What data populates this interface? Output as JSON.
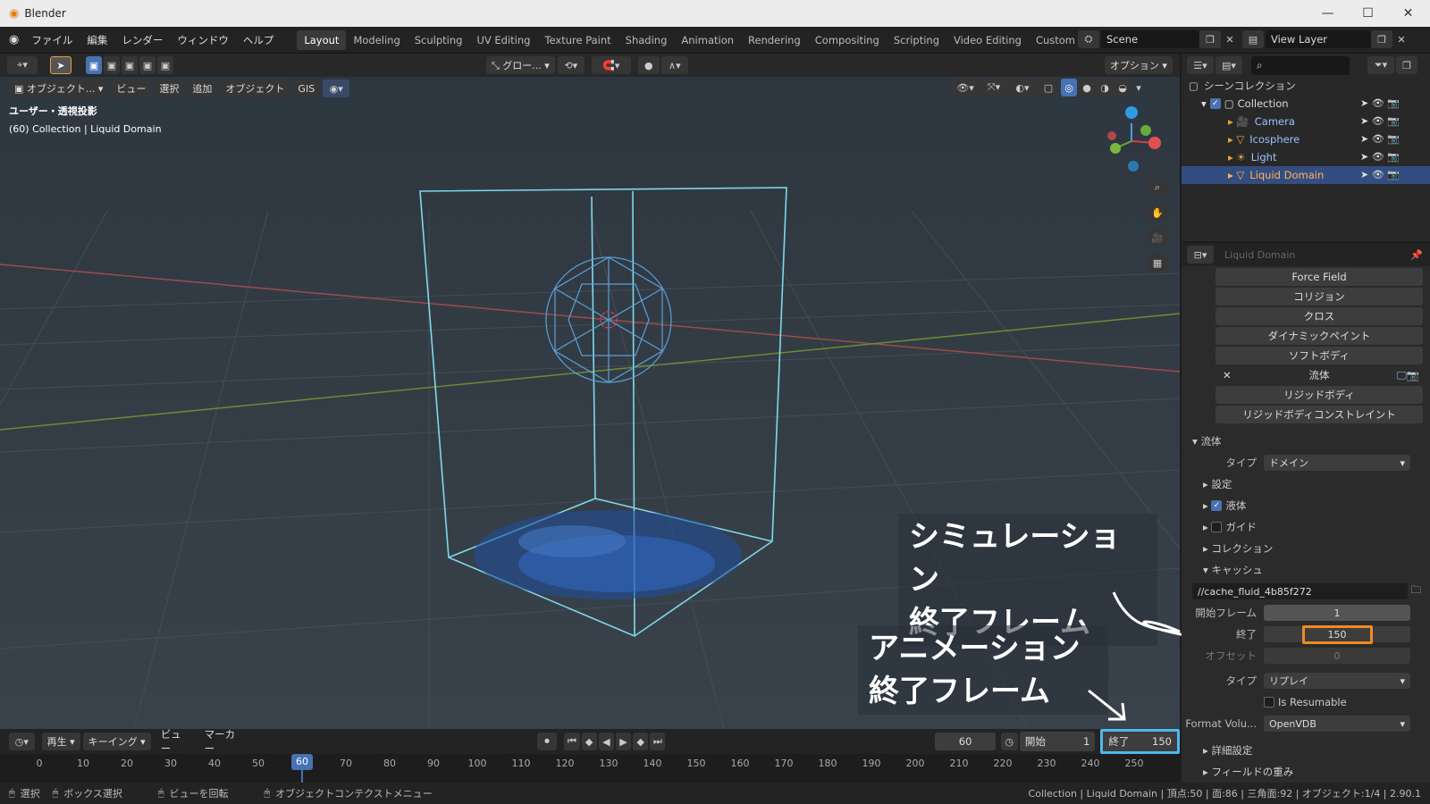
{
  "title_bar": {
    "app_name": "Blender"
  },
  "menu": [
    "ファイル",
    "編集",
    "レンダー",
    "ウィンドウ",
    "ヘルプ"
  ],
  "workspaces": [
    "Layout",
    "Modeling",
    "Sculpting",
    "UV Editing",
    "Texture Paint",
    "Shading",
    "Animation",
    "Rendering",
    "Compositing",
    "Scripting",
    "Video Editing",
    "Custom"
  ],
  "scene_name": "Scene",
  "view_layer": "View Layer",
  "toolbar": {
    "transform": "グロー...",
    "options": "オプション"
  },
  "header": {
    "mode": "オブジェクト...",
    "view": "ビュー",
    "select": "選択",
    "add": "追加",
    "object": "オブジェクト",
    "gis": "GIS"
  },
  "viewport": {
    "projection": "ユーザー・透視投影",
    "collection_info": "(60) Collection | Liquid Domain"
  },
  "outliner": {
    "root": "シーンコレクション",
    "items": [
      "Collection",
      "Camera",
      "Icosphere",
      "Light",
      "Liquid Domain"
    ]
  },
  "properties": {
    "object_name": "Liquid Domain",
    "physics_buttons": [
      "Force Field",
      "コリジョン",
      "クロス",
      "ダイナミックペイント",
      "ソフトボディ",
      "流体",
      "リジッドボディ",
      "リジッドボディコンストレイント"
    ],
    "fluid_panel": "流体",
    "type_label": "タイプ",
    "type_value": "ドメイン",
    "settings": "設定",
    "liquid": "液体",
    "guide": "ガイド",
    "collections": "コレクション",
    "cache": "キャッシュ",
    "cache_path": "//cache_fluid_4b85f272",
    "start_label": "開始フレーム",
    "start_value": "1",
    "end_label": "終了",
    "end_value": "150",
    "offset_label": "オフセット",
    "offset_value": "0",
    "cache_type_label": "タイプ",
    "cache_type_value": "リプレイ",
    "resumable": "Is Resumable",
    "format_label": "Format Volu...",
    "format_value": "OpenVDB",
    "advanced": "詳細設定",
    "field_weights": "フィールドの重み"
  },
  "timeline": {
    "playback": "再生",
    "keying": "キーイング",
    "view": "ビュー",
    "marker": "マーカー",
    "current": "60",
    "start_label": "開始",
    "start": "1",
    "end_label": "終了",
    "end": "150",
    "ticks": [
      "0",
      "10",
      "20",
      "30",
      "40",
      "50",
      "60",
      "70",
      "80",
      "90",
      "100",
      "110",
      "120",
      "130",
      "140",
      "150",
      "160",
      "170",
      "180",
      "190",
      "200",
      "210",
      "220",
      "230",
      "240",
      "250"
    ]
  },
  "annotations": {
    "sim_end": [
      "シミュレーション",
      "終了フレーム"
    ],
    "anim_end": [
      "アニメーション",
      "終了フレーム"
    ]
  },
  "status": {
    "select": "選択",
    "box_select": "ボックス選択",
    "rotate": "ビューを回転",
    "context": "オブジェクトコンテクストメニュー",
    "info": "Collection | Liquid Domain | 頂点:50 | 面:86 | 三角面:92 | オブジェクト:1/4 | 2.90.1"
  }
}
